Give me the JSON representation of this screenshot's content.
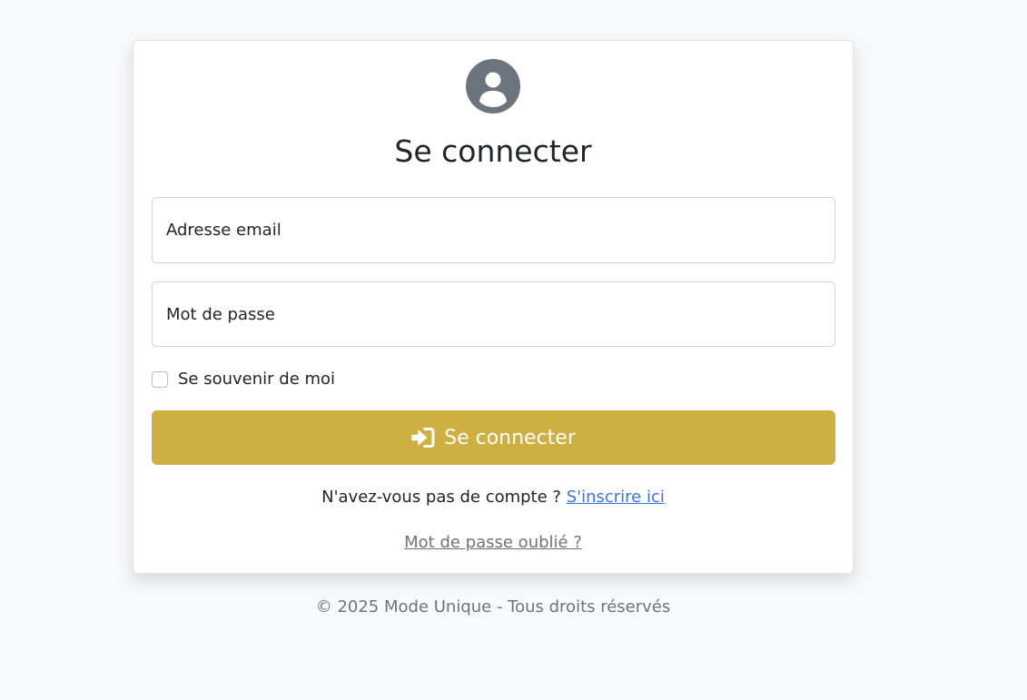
{
  "login": {
    "avatar_icon": "user-circle-icon",
    "title": "Se connecter",
    "email": {
      "label": "Adresse email",
      "value": ""
    },
    "password": {
      "label": "Mot de passe",
      "value": ""
    },
    "remember": {
      "label": "Se souvenir de moi",
      "checked": false
    },
    "submit": {
      "icon": "sign-in-icon",
      "label": "Se connecter"
    },
    "signup": {
      "prompt": "N'avez-vous pas de compte ?",
      "link": "S'inscrire ici"
    },
    "forgot_password": "Mot de passe oublié ?"
  },
  "footer": {
    "text": "© 2025 Mode Unique - Tous droits réservés"
  },
  "colors": {
    "background": "#f8f9fa",
    "accent": "#cdaf42",
    "link": "#3a72e8",
    "muted": "#6c757d"
  }
}
